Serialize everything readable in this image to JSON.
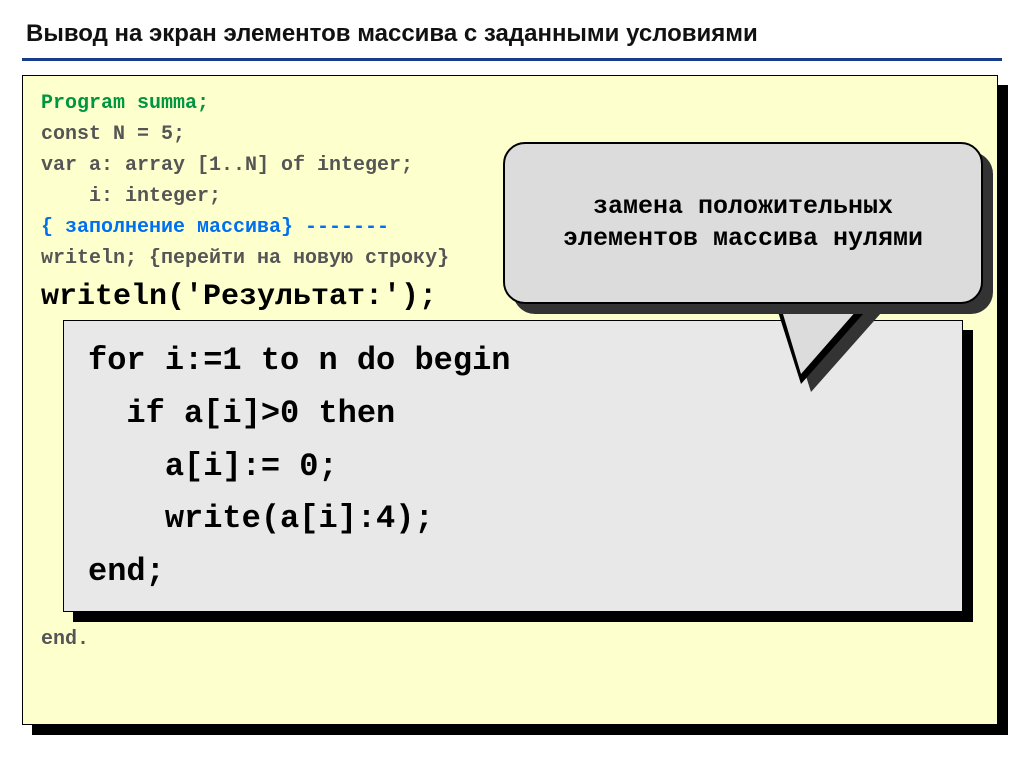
{
  "title": "Вывод на экран элементов массива с заданными условиями",
  "code": {
    "l1": "Program summa;",
    "l2": "const N = 5;",
    "l3": "var a: array [1..N] of integer;",
    "l4": "    i: integer;",
    "l5a": "{ заполнение массива}",
    "l5b": " -------",
    "l6": "writeln; {перейти на новую строку}",
    "l7": "writeln('Результат:');",
    "end": "end."
  },
  "inner": {
    "l1": "for i:=1 to n do begin",
    "l2": "  if a[i]>0 then",
    "l3": "    a[i]:= 0;",
    "l4": "    write(a[i]:4);",
    "l5": "end;"
  },
  "callout": {
    "text": "замена положительных элементов массива нулями"
  }
}
